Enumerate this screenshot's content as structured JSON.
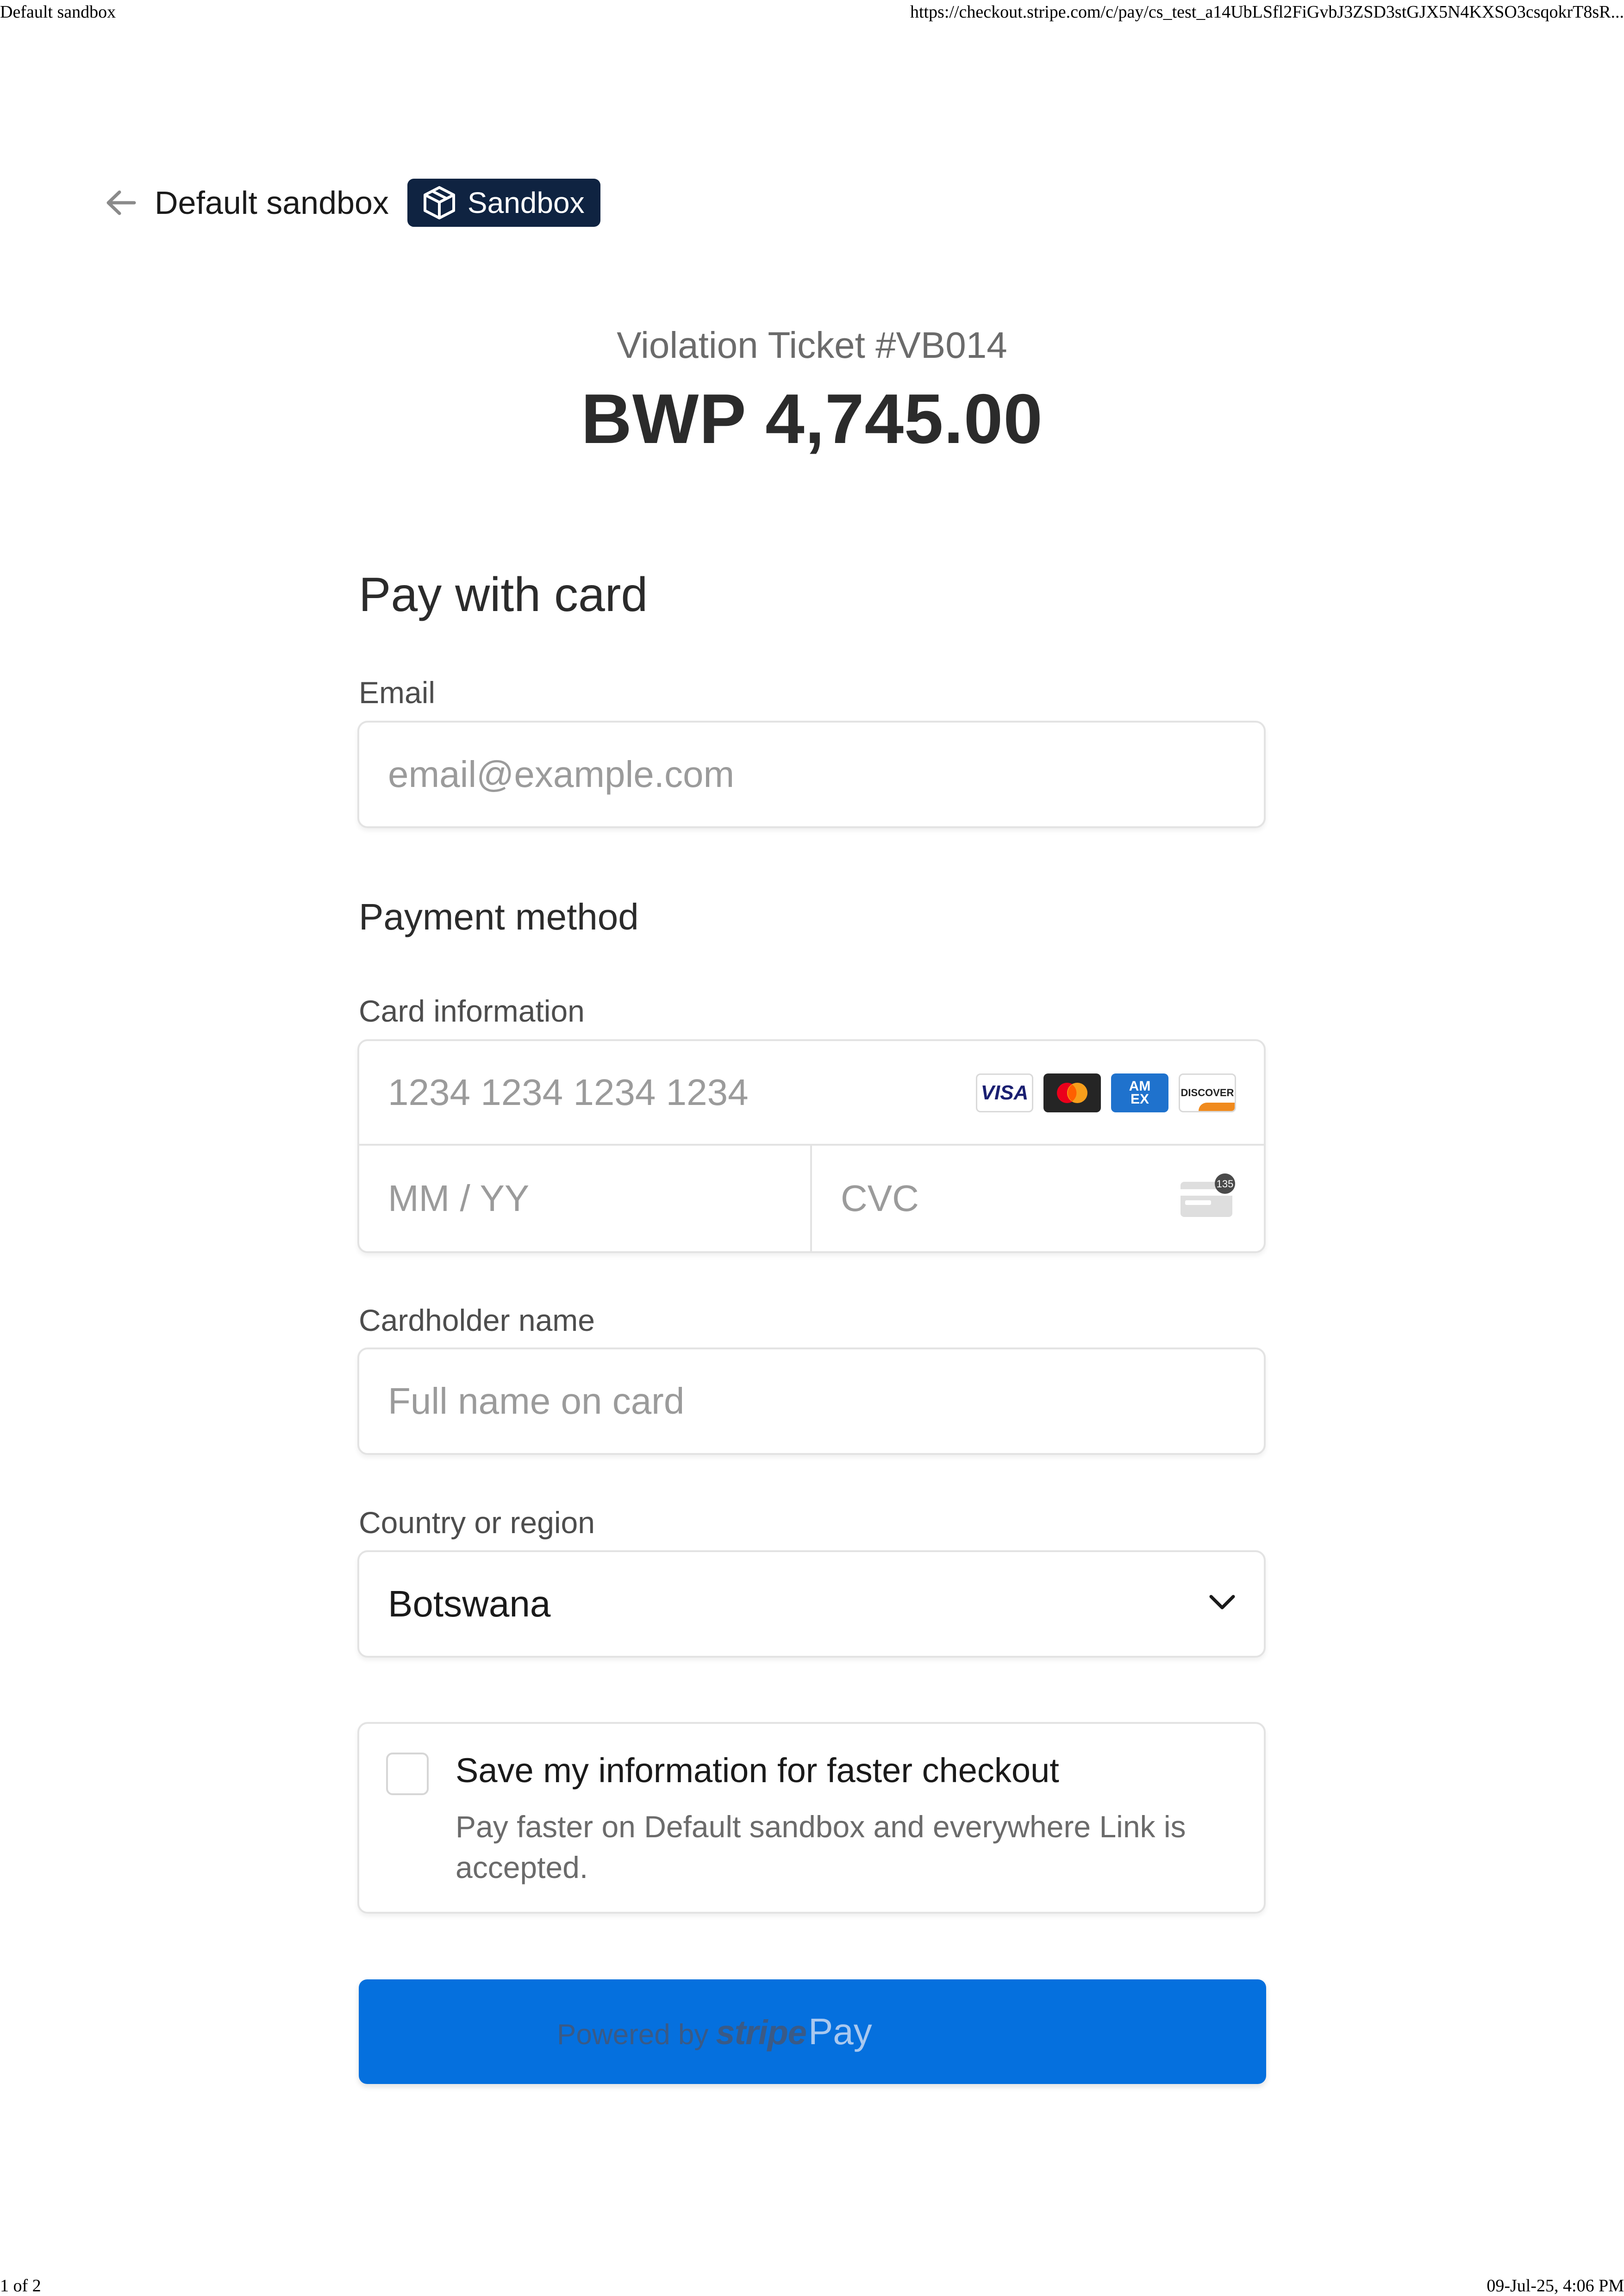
{
  "print": {
    "title": "Default sandbox",
    "url": "https://checkout.stripe.com/c/pay/cs_test_a14UbLSfl2FiGvbJ3ZSD3stGJX5N4KXSO3csqokrT8sR...",
    "page": "1 of 2",
    "datetime": "09-Jul-25, 4:06 PM"
  },
  "header": {
    "merchant_name": "Default sandbox",
    "badge_label": "Sandbox"
  },
  "summary": {
    "product_name": "Violation Ticket #VB014",
    "amount": "BWP 4,745.00"
  },
  "form": {
    "title": "Pay with card",
    "email": {
      "label": "Email",
      "placeholder": "email@example.com"
    },
    "payment_method_title": "Payment method",
    "card": {
      "label": "Card information",
      "number_placeholder": "1234 1234 1234 1234",
      "expiry_placeholder": "MM / YY",
      "cvc_placeholder": "CVC",
      "brands": [
        "visa",
        "mastercard",
        "amex",
        "discover"
      ],
      "brand_labels": {
        "visa": "VISA",
        "amex_top": "AM",
        "amex_bottom": "EX",
        "discover": "DISCOVER"
      },
      "cvc_icon_badge": "135"
    },
    "cardholder": {
      "label": "Cardholder name",
      "placeholder": "Full name on card"
    },
    "country": {
      "label": "Country or region",
      "selected": "Botswana"
    },
    "link_save": {
      "title": "Save my information for faster checkout",
      "description": "Pay faster on Default sandbox and everywhere Link is accepted.",
      "checked": false
    },
    "pay_button": {
      "powered_by": "Powered by",
      "stripe_word": "stripe",
      "label": "Pay",
      "color": "#0570de"
    }
  },
  "colors": {
    "badge_bg": "#0f2341",
    "border": "#e3e3e3",
    "placeholder": "#9b9b9b"
  }
}
